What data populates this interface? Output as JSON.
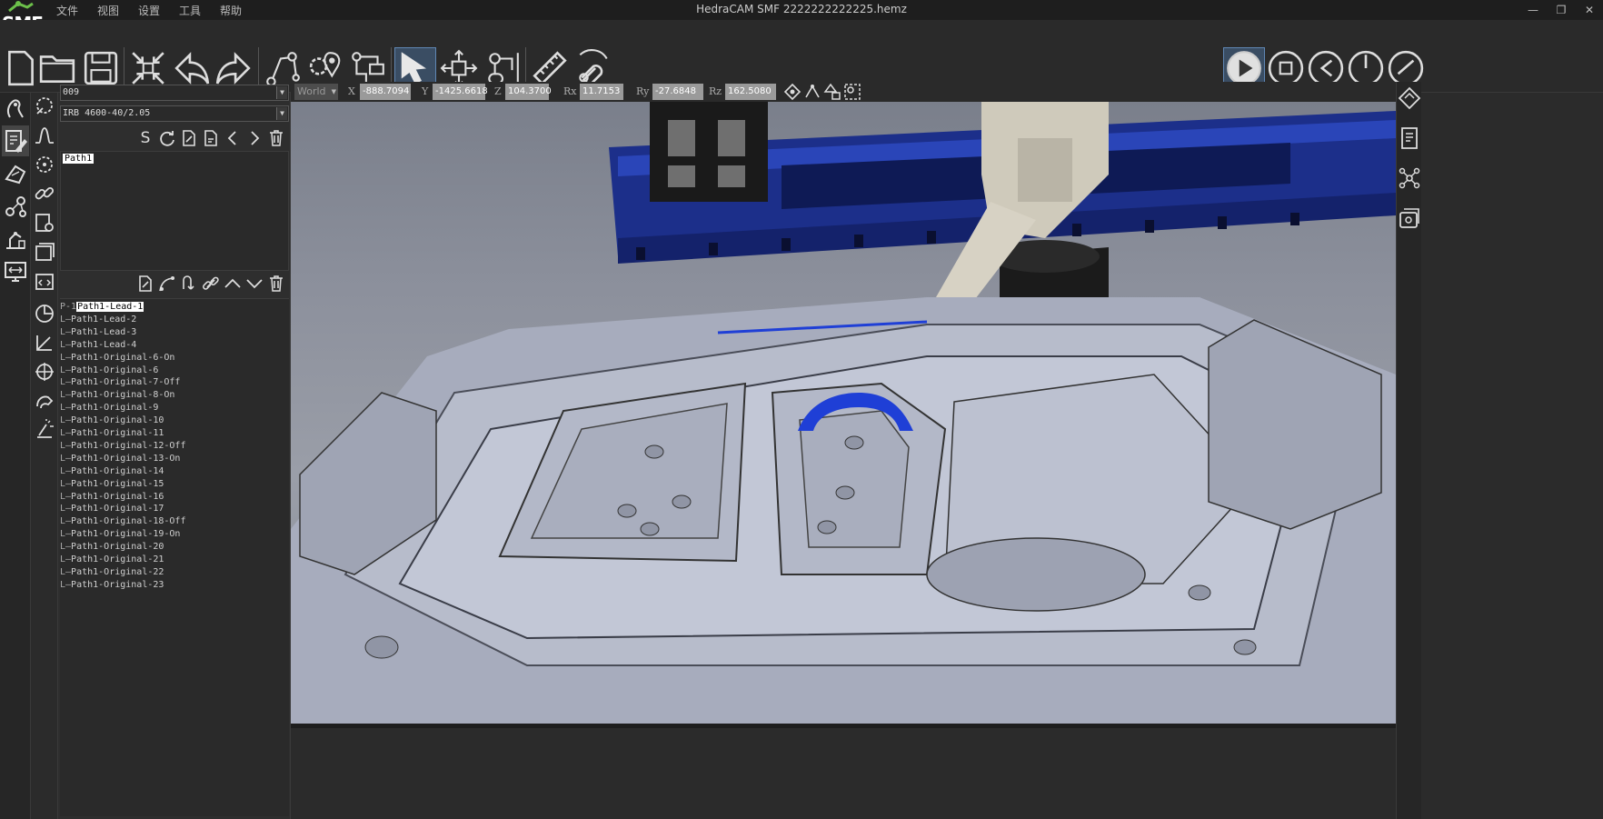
{
  "app": {
    "logo_text": "SMF",
    "window_title": "HedraCAM SMF  2222222222225.hemz",
    "menu": [
      "文件",
      "视图",
      "设置",
      "工具",
      "帮助"
    ]
  },
  "toolbar": {
    "icons": [
      "new-file",
      "open-folder",
      "save",
      "fit-view",
      "undo",
      "redo",
      "path-planning",
      "point-edit",
      "robot-setup",
      "select-cursor",
      "move-axes",
      "robot-teach",
      "ruler",
      "magnet"
    ],
    "playback": [
      "play",
      "stop",
      "step-back",
      "timer",
      "gauge"
    ]
  },
  "panel": {
    "program": "009",
    "robot_model": "IRB 4600-40/2.05",
    "path_name": "Path1",
    "tree_root_prefix": "P-1",
    "tree_items": [
      "Path1-Lead-1",
      "Path1-Lead-2",
      "Path1-Lead-3",
      "Path1-Lead-4",
      "Path1-Original-6-On",
      "Path1-Original-6",
      "Path1-Original-7-Off",
      "Path1-Original-8-On",
      "Path1-Original-9",
      "Path1-Original-10",
      "Path1-Original-11",
      "Path1-Original-12-Off",
      "Path1-Original-13-On",
      "Path1-Original-14",
      "Path1-Original-15",
      "Path1-Original-16",
      "Path1-Original-17",
      "Path1-Original-18-Off",
      "Path1-Original-19-On",
      "Path1-Original-20",
      "Path1-Original-21",
      "Path1-Original-22",
      "Path1-Original-23"
    ],
    "path_toolbar_first_label": "S"
  },
  "coords": {
    "frame": "World",
    "x_label": "X",
    "x": "-888.7094",
    "y_label": "Y",
    "y": "-1425.6618",
    "z_label": "Z",
    "z": "104.3700",
    "rx_label": "Rx",
    "rx": "11.7153",
    "ry_label": "Ry",
    "ry": "-27.6848",
    "rz_label": "Rz",
    "rz": "162.5080"
  },
  "colors": {
    "accent_blue": "#1f3fd6",
    "gantry_blue": "#1c2f8a",
    "part_gray": "#a7acbd",
    "robot_beige": "#cfcabb"
  }
}
